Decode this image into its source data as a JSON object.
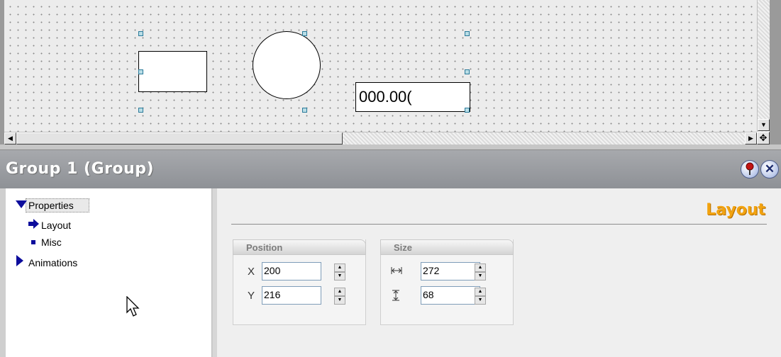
{
  "canvas": {
    "io_field_value": "000.00("
  },
  "panel": {
    "title": "Group 1 (Group)",
    "pin_icon": "pin-icon",
    "close_icon": "close-icon"
  },
  "tree": {
    "items": [
      {
        "label": "Properties",
        "icon": "triangle-down-icon"
      },
      {
        "label": "Layout",
        "icon": "arrow-right-icon"
      },
      {
        "label": "Misc",
        "icon": "square-bullet-icon"
      },
      {
        "label": "Animations",
        "icon": "triangle-right-icon"
      }
    ]
  },
  "content": {
    "section_title": "Layout",
    "position": {
      "group_label": "Position",
      "x_label": "X",
      "x_value": "200",
      "y_label": "Y",
      "y_value": "216"
    },
    "size": {
      "group_label": "Size",
      "width_icon": "width-icon",
      "width_value": "272",
      "height_icon": "height-icon",
      "height_value": "68"
    }
  },
  "colors": {
    "section_title": "#f2a310",
    "panel_header": "#9a9ca1",
    "selection_handle": "#b9dde6"
  }
}
